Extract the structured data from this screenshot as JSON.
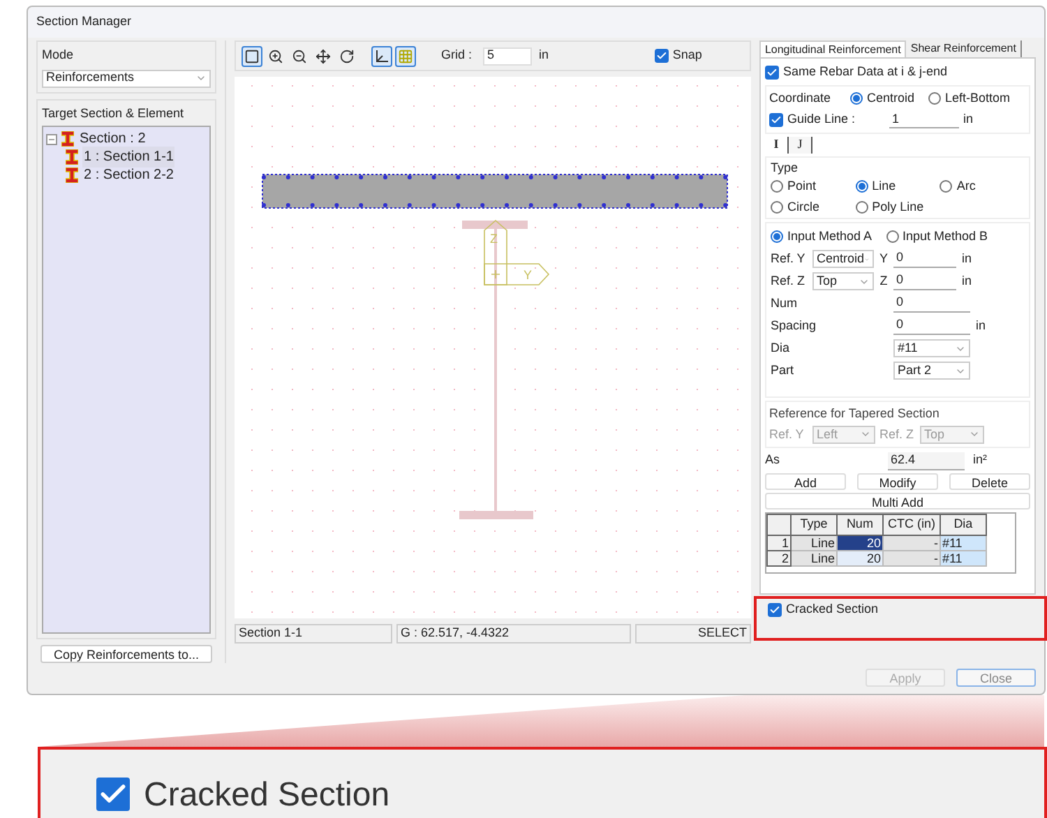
{
  "window": {
    "title": "Section Manager"
  },
  "mode": {
    "label": "Mode",
    "value": "Reinforcements"
  },
  "target": {
    "label": "Target Section & Element",
    "tree": [
      {
        "label": "Section : 2",
        "expanded": true,
        "children": [
          {
            "label": "1 : Section 1-1",
            "selected": true
          },
          {
            "label": "2 : Section 2-2",
            "selected": false
          }
        ]
      }
    ]
  },
  "copy_button": "Copy Reinforcements to...",
  "toolbar": {
    "tools": [
      {
        "kind": "fit",
        "selected": true
      },
      {
        "kind": "zoom-in",
        "selected": false
      },
      {
        "kind": "zoom-out",
        "selected": false
      },
      {
        "kind": "pan",
        "selected": false
      },
      {
        "kind": "rotate",
        "selected": false
      },
      {
        "kind": "axis",
        "selected": true
      },
      {
        "kind": "grid",
        "selected": true
      }
    ],
    "grid_label": "Grid :",
    "grid_value": "5",
    "grid_unit": "in",
    "snap": {
      "label": "Snap",
      "checked": true
    }
  },
  "canvas": {
    "axis_labels": [
      "Z",
      "Y"
    ]
  },
  "status_bar": [
    "Section 1-1",
    "G : 62.517, -4.4322",
    "SELECT"
  ],
  "tabs": [
    {
      "label": "Longitudinal Reinforcement",
      "selected": true
    },
    {
      "label": "Shear Reinforcement",
      "selected": false
    }
  ],
  "same_rebar": {
    "label": "Same Rebar Data at i & j-end",
    "checked": true
  },
  "coordinate": {
    "label": "Coordinate",
    "options": [
      {
        "label": "Centroid",
        "selected": true
      },
      {
        "label": "Left-Bottom",
        "selected": false
      }
    ]
  },
  "guide_line": {
    "label": "Guide Line :",
    "checked": true,
    "value": "1",
    "unit": "in"
  },
  "end_tabs": [
    {
      "label": "I",
      "selected": true
    },
    {
      "label": "J",
      "selected": false
    }
  ],
  "type": {
    "label": "Type",
    "options": [
      {
        "label": "Point",
        "selected": false
      },
      {
        "label": "Line",
        "selected": true
      },
      {
        "label": "Arc",
        "selected": false
      },
      {
        "label": "Circle",
        "selected": false
      },
      {
        "label": "Poly Line",
        "selected": false
      }
    ]
  },
  "input_methods": [
    {
      "label": "Input Method A",
      "selected": true
    },
    {
      "label": "Input Method B",
      "selected": false
    }
  ],
  "fields": [
    {
      "kind": "select-input",
      "label": "Ref. Y",
      "select": "Centroid",
      "axis": "Y",
      "value": "0",
      "unit": "in"
    },
    {
      "kind": "select-input",
      "label": "Ref. Z",
      "select": "Top",
      "axis": "Z",
      "value": "0",
      "unit": "in"
    },
    {
      "kind": "input",
      "label": "Num",
      "value": "0"
    },
    {
      "kind": "input",
      "label": "Spacing",
      "value": "0",
      "unit": "in"
    },
    {
      "kind": "select",
      "label": "Dia",
      "value": "#11"
    },
    {
      "kind": "select",
      "label": "Part",
      "value": "Part 2"
    }
  ],
  "tapered": {
    "label": "Reference for Tapered Section",
    "disabled": true,
    "ref_y": {
      "label": "Ref. Y",
      "value": "Left"
    },
    "ref_z": {
      "label": "Ref. Z",
      "value": "Top"
    }
  },
  "as": {
    "label": "As",
    "value": "62.4",
    "unit": "in²"
  },
  "actions": [
    "Add",
    "Modify",
    "Delete"
  ],
  "multi_add": "Multi Add",
  "table": {
    "columns": [
      "Type",
      "Num",
      "CTC (in)",
      "Dia"
    ],
    "rows": [
      {
        "index": "1",
        "cells": [
          "Line",
          "20",
          "-",
          "#11"
        ],
        "selected": true
      },
      {
        "index": "2",
        "cells": [
          "Line",
          "20",
          "-",
          "#11"
        ],
        "selected": false
      }
    ]
  },
  "cracked": {
    "label": "Cracked Section",
    "checked": true
  },
  "buttons": [
    {
      "label": "Apply",
      "disabled": true
    },
    {
      "label": "Close",
      "disabled": false
    }
  ],
  "callout": {
    "label": "Cracked Section",
    "checked": true
  }
}
